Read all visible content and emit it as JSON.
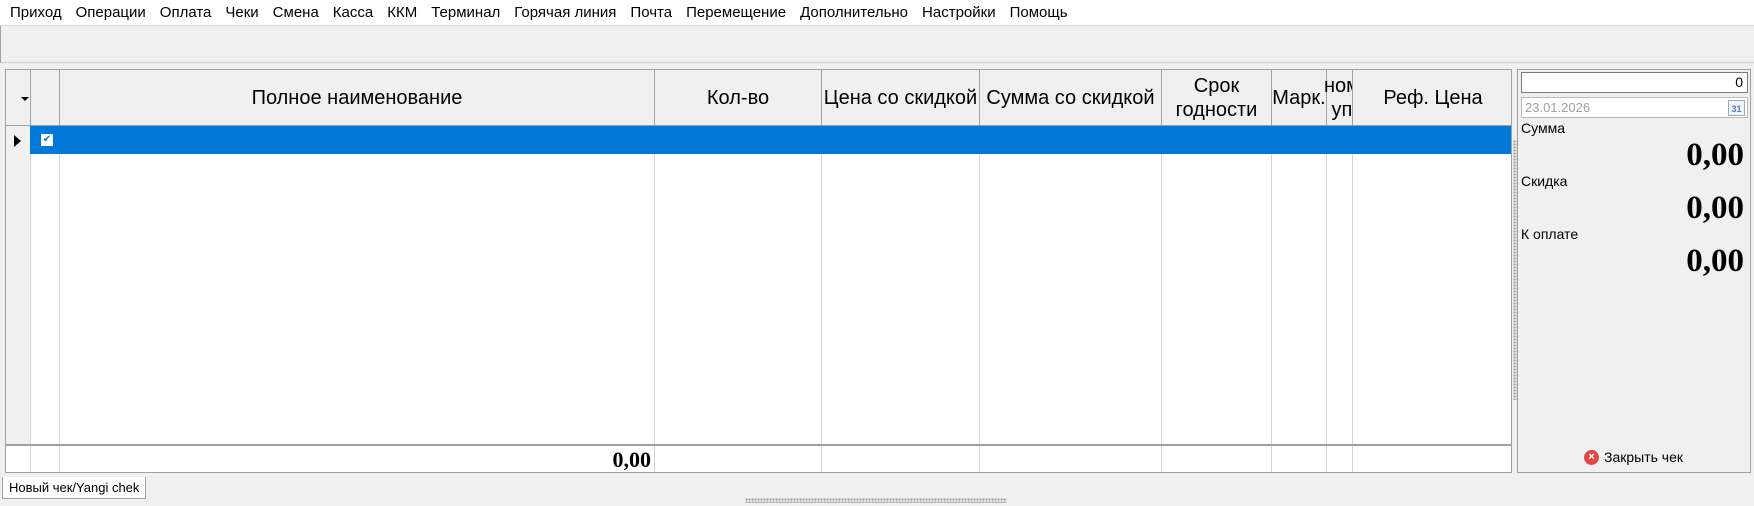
{
  "menu": [
    "Приход",
    "Операции",
    "Оплата",
    "Чеки",
    "Смена",
    "Касса",
    "ККМ",
    "Терминал",
    "Горячая линия",
    "Почта",
    "Перемещение",
    "Дополнительно",
    "Настройки",
    "Помощь"
  ],
  "grid": {
    "columns": [
      "Полное наименование",
      "Кол-во",
      "Цена со скидкой",
      "Сумма со скидкой",
      "Срок годности",
      "Марк.",
      "ном. уп.",
      "Реф. Цена"
    ],
    "selected_row_checked": true,
    "footer_total": "0,00"
  },
  "panel": {
    "number_value": "0",
    "date_value": "23.01.2026",
    "calendar_icon_text": "31",
    "sum_label": "Сумма",
    "sum_value": "0,00",
    "discount_label": "Скидка",
    "discount_value": "0,00",
    "to_pay_label": "К оплате",
    "to_pay_value": "0,00",
    "close_label": "Закрыть чек"
  },
  "tabs": [
    "Новый чек/Yangi chek"
  ],
  "colors": {
    "selection": "#0078d7",
    "close_icon": "#e04848"
  }
}
